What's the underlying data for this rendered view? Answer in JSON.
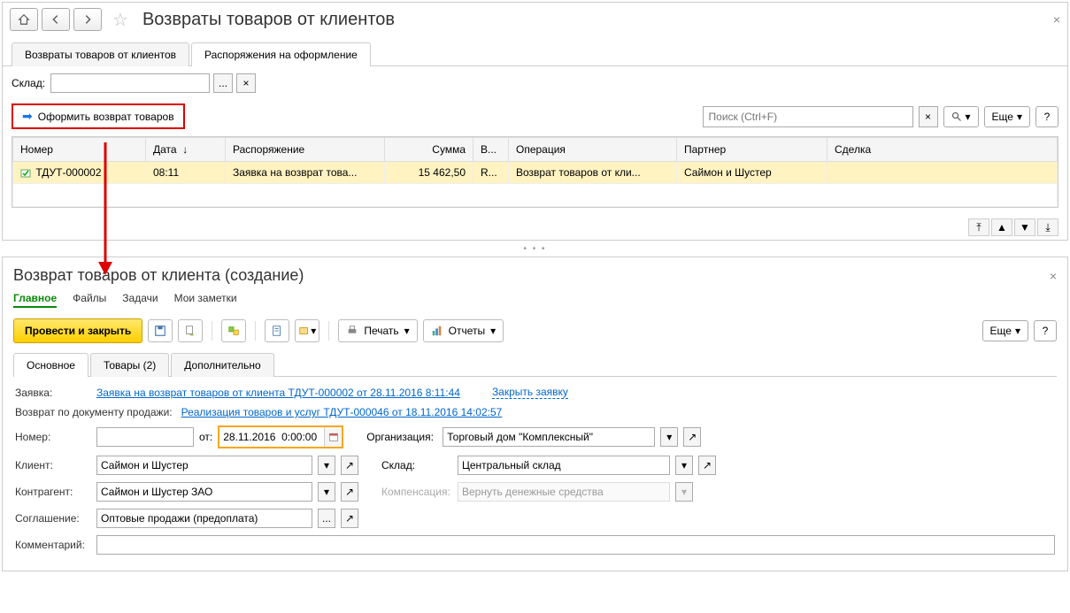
{
  "top": {
    "title": "Возвраты товаров от клиентов",
    "tabs": [
      "Возвраты товаров от клиентов",
      "Распоряжения на оформление"
    ],
    "active_tab": 1,
    "filter_label": "Склад:",
    "action_button": "Оформить возврат товаров",
    "search_placeholder": "Поиск (Ctrl+F)",
    "more": "Еще",
    "help": "?",
    "columns": [
      "Номер",
      "Дата",
      "Распоряжение",
      "Сумма",
      "В...",
      "Операция",
      "Партнер",
      "Сделка"
    ],
    "row": {
      "number": "ТДУТ-000002",
      "date": "08:11",
      "order": "Заявка на возврат това...",
      "sum": "15 462,50",
      "cur": "R...",
      "op": "Возврат товаров от кли...",
      "partner": "Саймон и Шустер",
      "deal": ""
    }
  },
  "bottom": {
    "title": "Возврат товаров от клиента (создание)",
    "subtabs": [
      "Главное",
      "Файлы",
      "Задачи",
      "Мои заметки"
    ],
    "active_subtab": 0,
    "yellow": "Провести и закрыть",
    "print": "Печать",
    "reports": "Отчеты",
    "more": "Еще",
    "help": "?",
    "form_tabs": [
      "Основное",
      "Товары (2)",
      "Дополнительно"
    ],
    "active_form_tab": 0,
    "f": {
      "request_label": "Заявка:",
      "request_link": "Заявка на возврат товаров от клиента ТДУТ-000002 от 28.11.2016 8:11:44",
      "close_request": "Закрыть заявку",
      "return_doc_label": "Возврат по документу продажи:",
      "return_doc_link": "Реализация товаров и услуг ТДУТ-000046 от 18.11.2016 14:02:57",
      "number_label": "Номер:",
      "ot": "от:",
      "date": "28.11.2016  0:00:00",
      "org_label": "Организация:",
      "org": "Торговый дом \"Комплексный\"",
      "client_label": "Клиент:",
      "client": "Саймон и Шустер",
      "warehouse_label": "Склад:",
      "warehouse": "Центральный склад",
      "contragent_label": "Контрагент:",
      "contragent": "Саймон и Шустер ЗАО",
      "comp_label": "Компенсация:",
      "comp": "Вернуть денежные средства",
      "agreement_label": "Соглашение:",
      "agreement": "Оптовые продажи (предоплата)",
      "comment_label": "Комментарий:"
    }
  }
}
